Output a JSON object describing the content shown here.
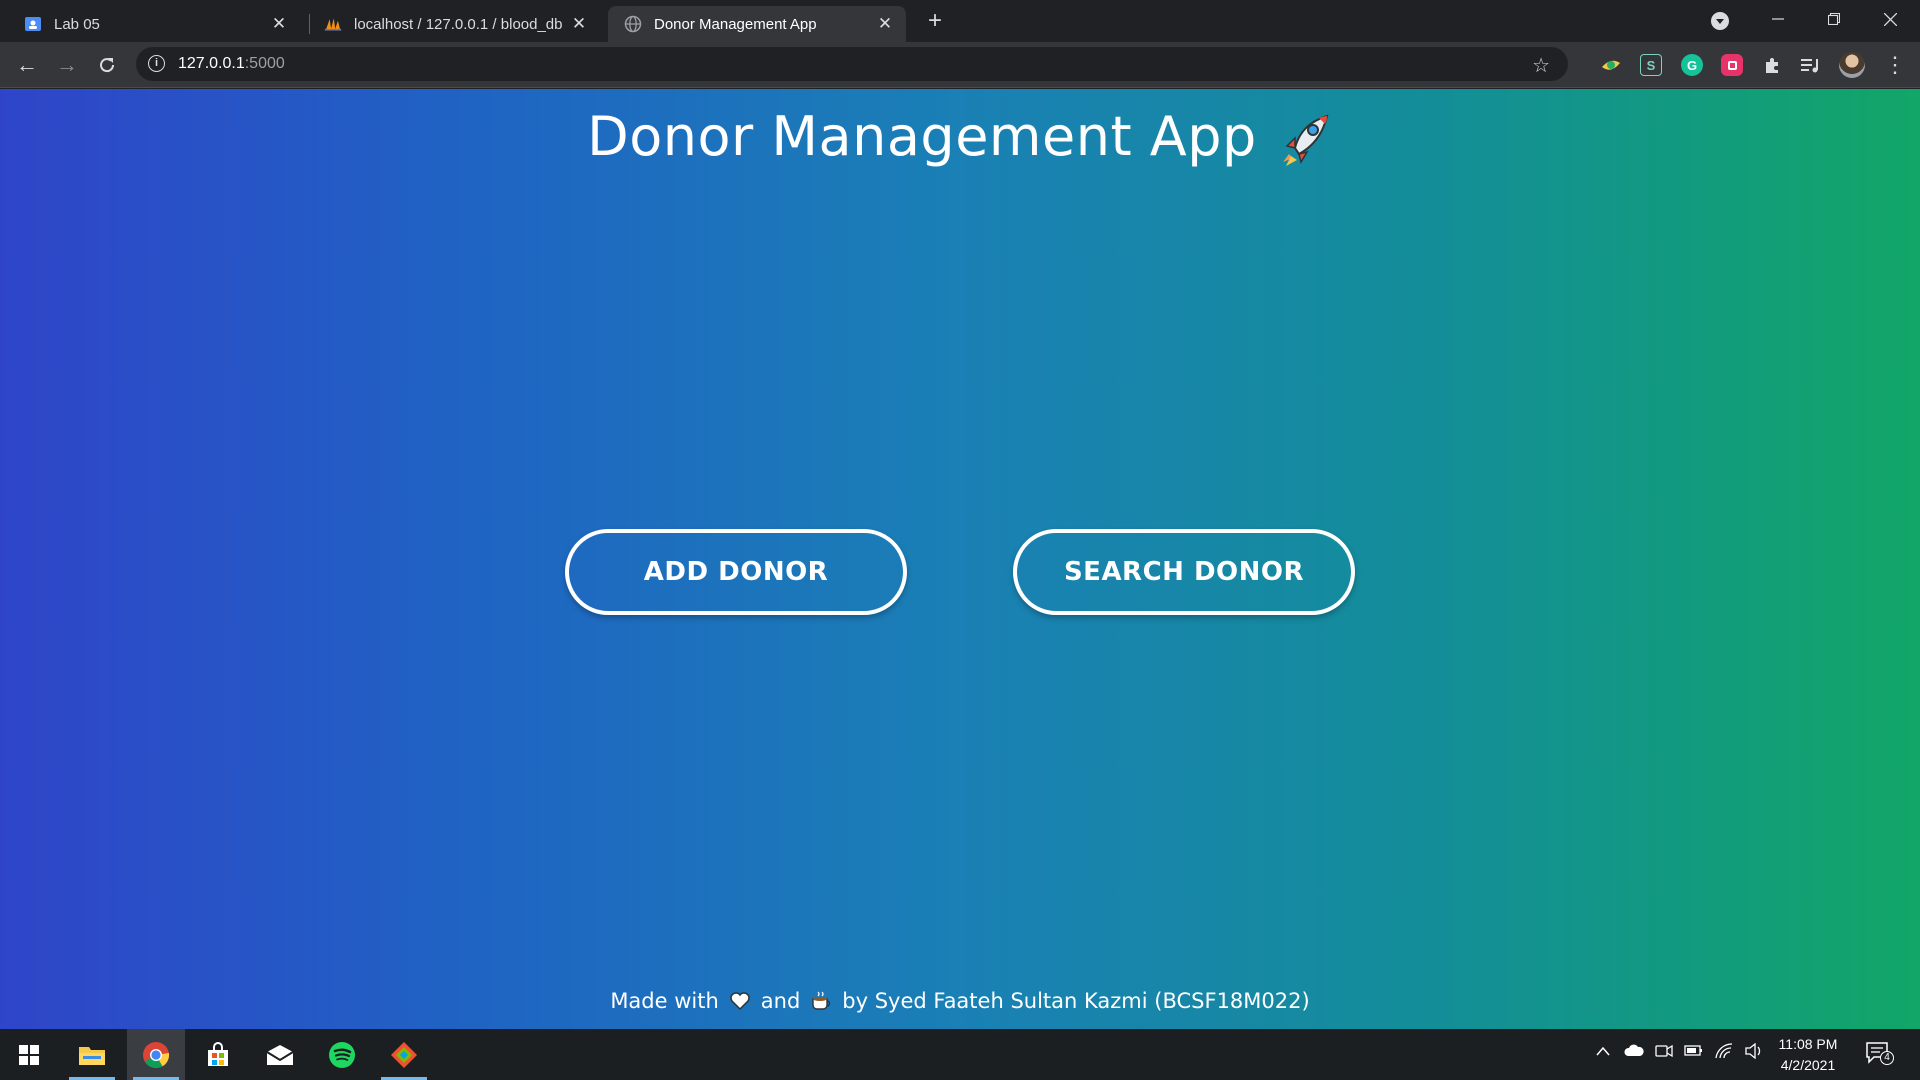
{
  "browser": {
    "tabs": [
      {
        "title": "Lab 05",
        "icon": "classroom-icon",
        "active": false
      },
      {
        "title": "localhost / 127.0.0.1 / blood_db /",
        "icon": "phpmyadmin-icon",
        "active": false
      },
      {
        "title": "Donor Management App",
        "icon": "globe-icon",
        "active": true
      }
    ],
    "url_host": "127.0.0.1",
    "url_port": ":5000"
  },
  "page": {
    "title": "Donor Management App",
    "add_button": "ADD DONOR",
    "search_button": "SEARCH DONOR",
    "footer": {
      "made_with": "Made with",
      "and": "and",
      "by": "by Syed Faateh Sultan Kazmi (BCSF18M022)"
    }
  },
  "taskbar": {
    "time": "11:08 PM",
    "date": "4/2/2021",
    "notification_count": "4"
  },
  "colors": {
    "gradient_start": "#2f45c9",
    "gradient_end": "#12a667",
    "button_border": "#ffffff"
  }
}
